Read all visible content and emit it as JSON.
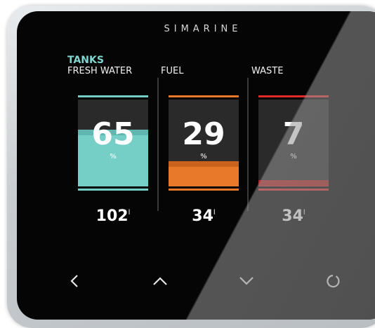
{
  "brand": "SIMARINE",
  "section": {
    "title": "TANKS"
  },
  "tanks": [
    {
      "label": "FRESH WATER",
      "percent": "65",
      "percent_unit": "%",
      "volume": "102",
      "volume_unit": "l",
      "level": 0.65,
      "color": "#76cfc7",
      "edge_color": "#5fb7af"
    },
    {
      "label": "FUEL",
      "percent": "29",
      "percent_unit": "%",
      "volume": "34",
      "volume_unit": "l",
      "level": 0.29,
      "color": "#e8782a",
      "edge_color": "#c9621d"
    },
    {
      "label": "WASTE",
      "percent": "7",
      "percent_unit": "%",
      "volume": "34",
      "volume_unit": "l",
      "level": 0.07,
      "color": "#e02a2a",
      "edge_color": "#b31e1e"
    }
  ],
  "nav": [
    {
      "name": "back",
      "icon": "chevron-left-icon"
    },
    {
      "name": "up",
      "icon": "chevron-up-icon"
    },
    {
      "name": "down",
      "icon": "chevron-down-icon"
    },
    {
      "name": "home",
      "icon": "circle-icon"
    }
  ]
}
